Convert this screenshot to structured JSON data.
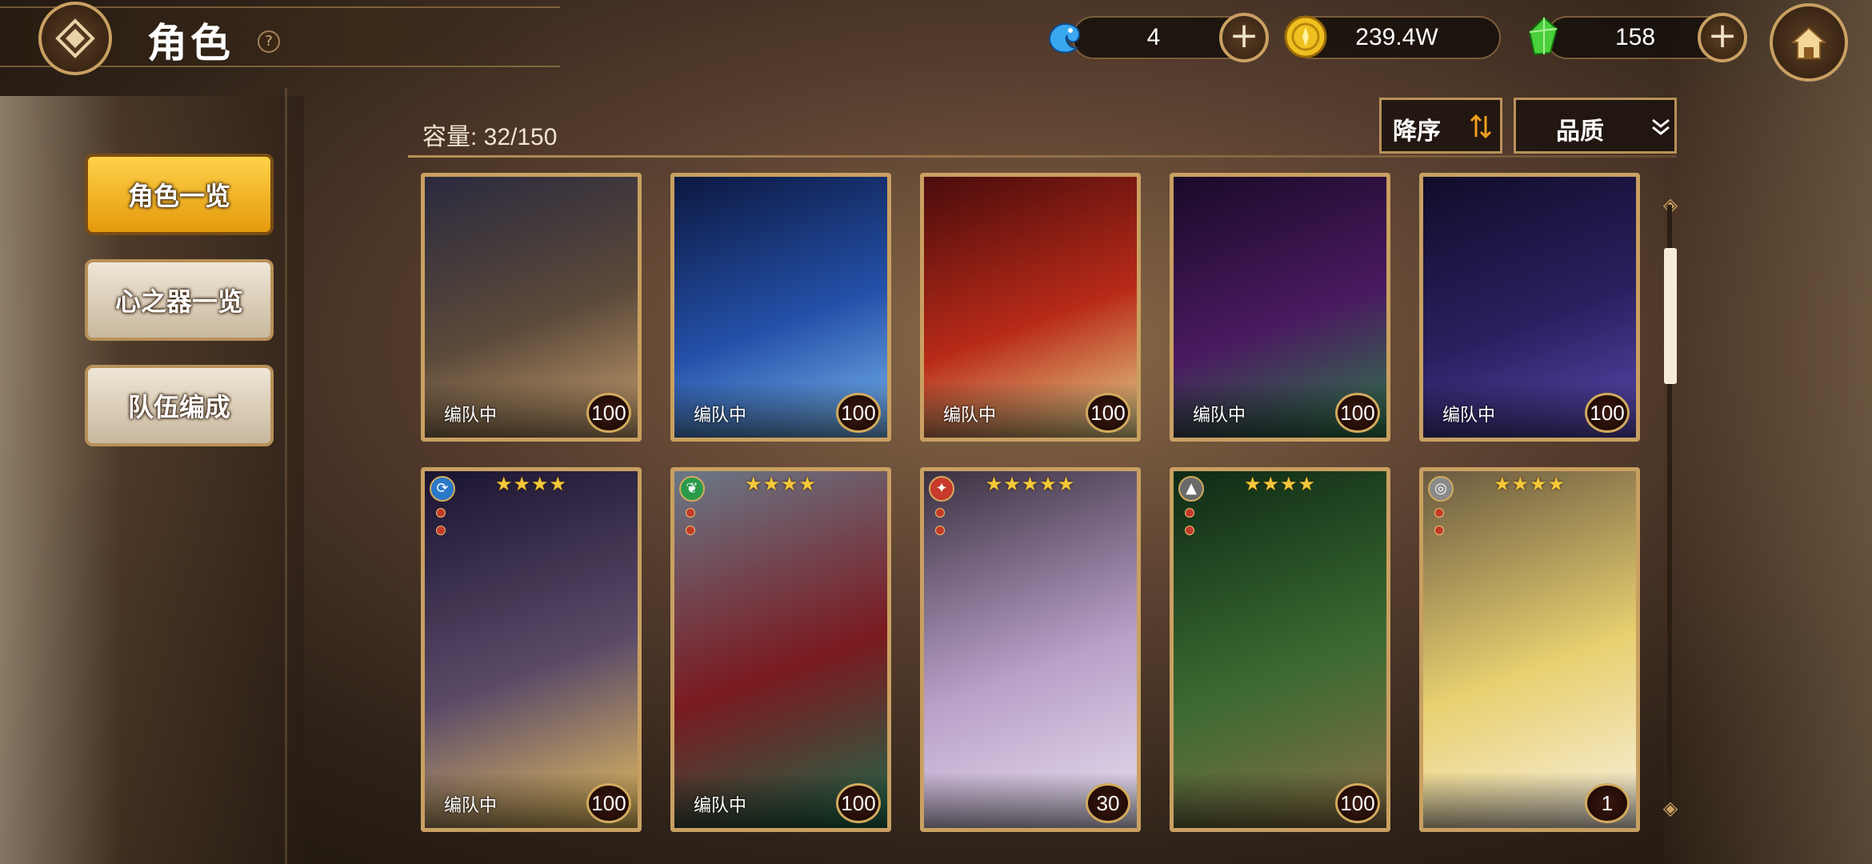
{
  "header": {
    "title": "角色",
    "help": "?"
  },
  "resources": [
    {
      "name": "stamina",
      "icon": "blue-bird-icon",
      "value": "4",
      "has_plus": true
    },
    {
      "name": "gold",
      "icon": "gold-coin-icon",
      "value": "239.4W",
      "has_plus": false
    },
    {
      "name": "crystal",
      "icon": "green-crystal-icon",
      "value": "158",
      "has_plus": true
    }
  ],
  "sidebar": {
    "items": [
      {
        "label": "角色一览",
        "active": true
      },
      {
        "label": "心之器一览",
        "active": false
      },
      {
        "label": "队伍编成",
        "active": false
      }
    ]
  },
  "list": {
    "capacity": "容量: 32/150",
    "sort_label": "降序",
    "sort_icon": "sort-arrows-icon",
    "filter_label": "品质",
    "filter_icon": "chevron-down-double-icon"
  },
  "cards": [
    {
      "status": "编队中",
      "level": "100",
      "stars": "",
      "element": "",
      "colors": [
        "#2a2a3e",
        "#5c4a3a",
        "#c8a070"
      ]
    },
    {
      "status": "编队中",
      "level": "100",
      "stars": "",
      "element": "",
      "colors": [
        "#0c1840",
        "#2450a8",
        "#7ab8f0"
      ]
    },
    {
      "status": "编队中",
      "level": "100",
      "stars": "",
      "element": "",
      "colors": [
        "#4a0c0c",
        "#b82a18",
        "#e8d890"
      ]
    },
    {
      "status": "编队中",
      "level": "100",
      "stars": "",
      "element": "",
      "colors": [
        "#1a0a28",
        "#4a1a60",
        "#2f7a4a"
      ]
    },
    {
      "status": "编队中",
      "level": "100",
      "stars": "",
      "element": "",
      "colors": [
        "#120c2a",
        "#2a2060",
        "#5a4ab0"
      ]
    },
    {
      "status": "编队中",
      "level": "100",
      "stars": "★★★★",
      "element": "⟳",
      "element_color": "#2a78c8",
      "colors": [
        "#1a1430",
        "#5a4a68",
        "#e8c060"
      ]
    },
    {
      "status": "编队中",
      "level": "100",
      "stars": "★★★★",
      "element": "❦",
      "element_color": "#2a9a4a",
      "colors": [
        "#6a7888",
        "#7a1a20",
        "#1e6a4a"
      ]
    },
    {
      "status": "",
      "level": "30",
      "stars": "★★★★★",
      "element": "✦",
      "element_color": "#c83a2a",
      "colors": [
        "#3a3040",
        "#b8a0c8",
        "#e8e0f0"
      ]
    },
    {
      "status": "",
      "level": "100",
      "stars": "★★★★",
      "element": "▲",
      "element_color": "#6a6a6a",
      "colors": [
        "#0e2a16",
        "#3a6a30",
        "#8a7048"
      ]
    },
    {
      "status": "",
      "level": "1",
      "stars": "★★★★",
      "element": "◎",
      "element_color": "#8a8a8a",
      "colors": [
        "#6a5a40",
        "#e8d070",
        "#f8f0e0"
      ]
    }
  ]
}
